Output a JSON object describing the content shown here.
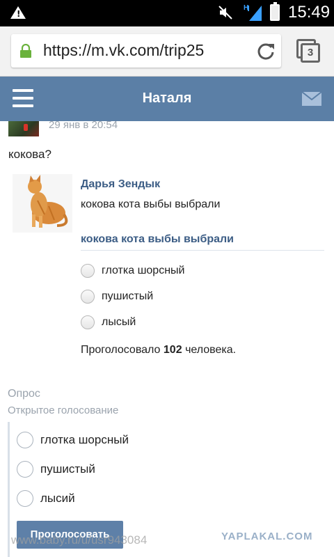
{
  "statusbar": {
    "time": "15:49",
    "tabs_count": "3"
  },
  "browser": {
    "url": "https://m.vk.com/trip25"
  },
  "header": {
    "title": "Наталя"
  },
  "post": {
    "date": "29 янв в 20:54",
    "text": "кокова?"
  },
  "embedded_screenshot": {
    "author": "Дарья Зендык",
    "question": "кокова кота выбы выбрали",
    "poll_title": "кокова кота выбы выбрали",
    "options": [
      "глотка шорсный",
      "пушистый",
      "лысый"
    ],
    "votes_prefix": "Проголосовало",
    "votes_count": "102",
    "votes_suffix": "человека."
  },
  "poll": {
    "type": "Опрос",
    "subtitle": "Открытое голосование",
    "options": [
      "глотка шорсный",
      "пушистый",
      "лысий"
    ],
    "button": "Проголосовать"
  },
  "watermarks": {
    "left": "www.baby.ru/u/usr943084",
    "right": "YAPLAKAL.COM"
  }
}
